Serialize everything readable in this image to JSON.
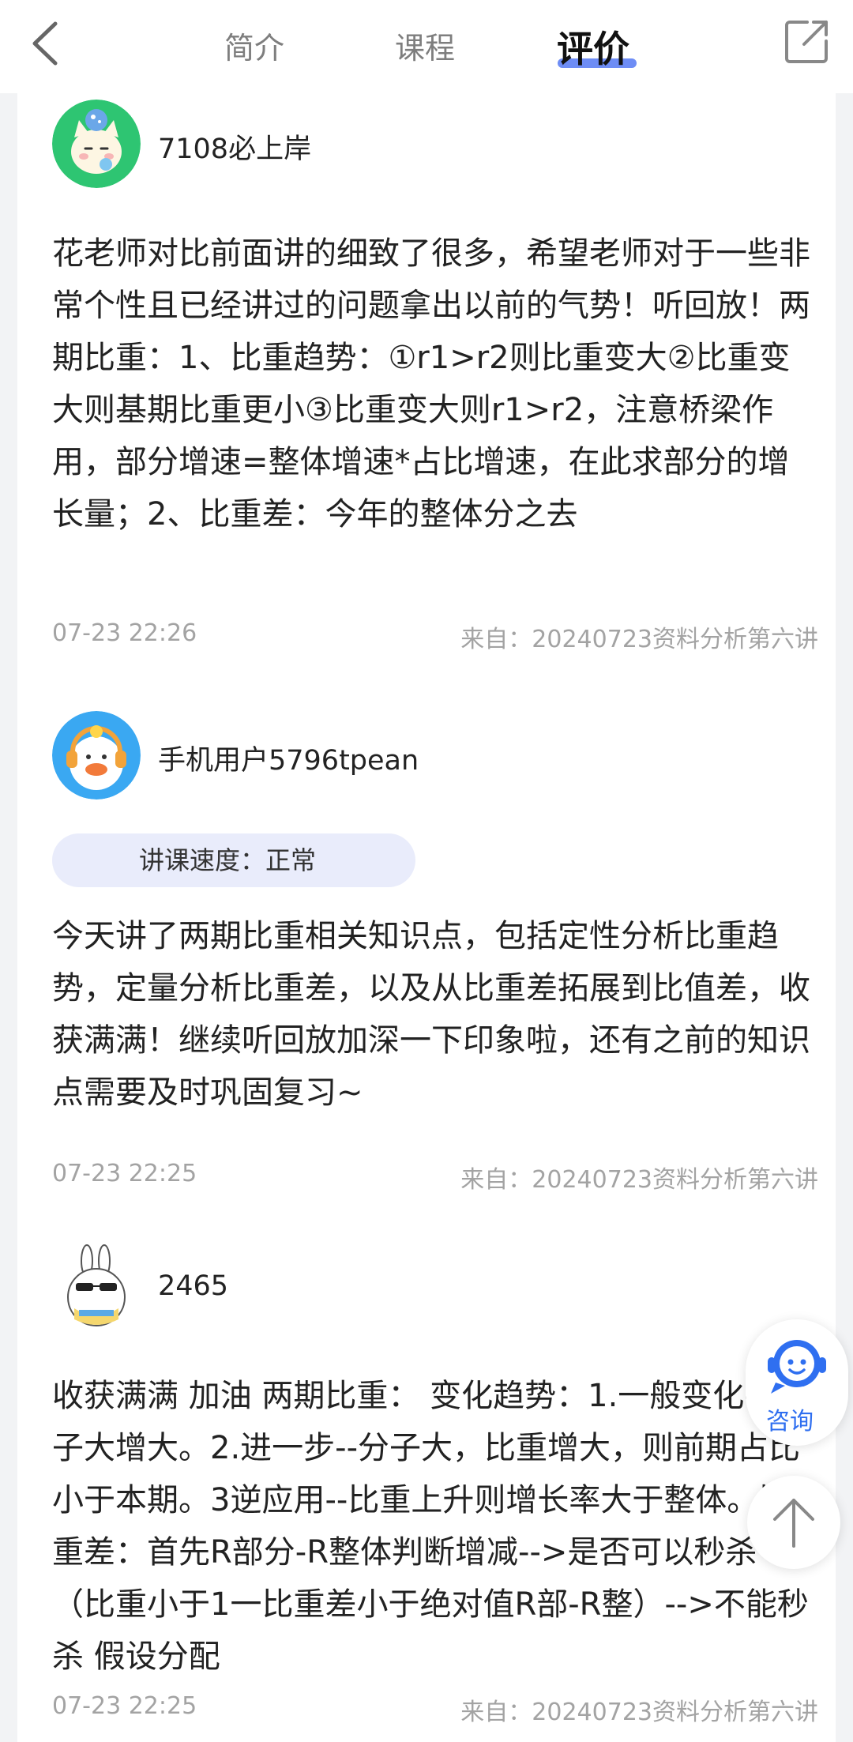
{
  "header": {
    "tabs": [
      {
        "label": "简介"
      },
      {
        "label": "课程"
      },
      {
        "label": "评价"
      }
    ]
  },
  "reviews": [
    {
      "username": "7108必上岸",
      "content": "花老师对比前面讲的细致了很多，希望老师对于一些非常个性且已经讲过的问题拿出以前的气势！听回放！两期比重：1、比重趋势：①r1>r2则比重变大②比重变大则基期比重更小③比重变大则r1>r2，注意桥梁作用，部分增速=整体增速*占比增速，在此求部分的增长量；2、比重差：今年的整体分之去",
      "date": "07-23 22:26",
      "source": "来自：20240723资料分析第六讲"
    },
    {
      "username": "手机用户5796tpean",
      "tag": "讲课速度：正常",
      "content": "今天讲了两期比重相关知识点，包括定性分析比重趋势，定量分析比重差，以及从比重差拓展到比值差，收获满满！继续听回放加深一下印象啦，还有之前的知识点需要及时巩固复习~",
      "date": "07-23 22:25",
      "source": "来自：20240723资料分析第六讲"
    },
    {
      "username": "2465",
      "content": "收获满满 加油 两期比重： 变化趋势：1.一般变化--分子大增大。2.进一步--分子大，比重增大，则前期占比小于本期。3逆应用--比重上升则增长率大于整体。比重差：首先R部分-R整体判断增减-->是否可以秒杀（比重小于1一比重差小于绝对值R部-R整）-->不能秒杀 假设分配",
      "date": "07-23 22:25",
      "source": "来自：20240723资料分析第六讲"
    }
  ],
  "floating": {
    "consult_label": "咨询"
  },
  "colors": {
    "accent": "#2f6ff0",
    "tab_underline": "#6e8df5",
    "meta_text": "#a3a3a3",
    "tag_bg": "#e9ecfb"
  }
}
